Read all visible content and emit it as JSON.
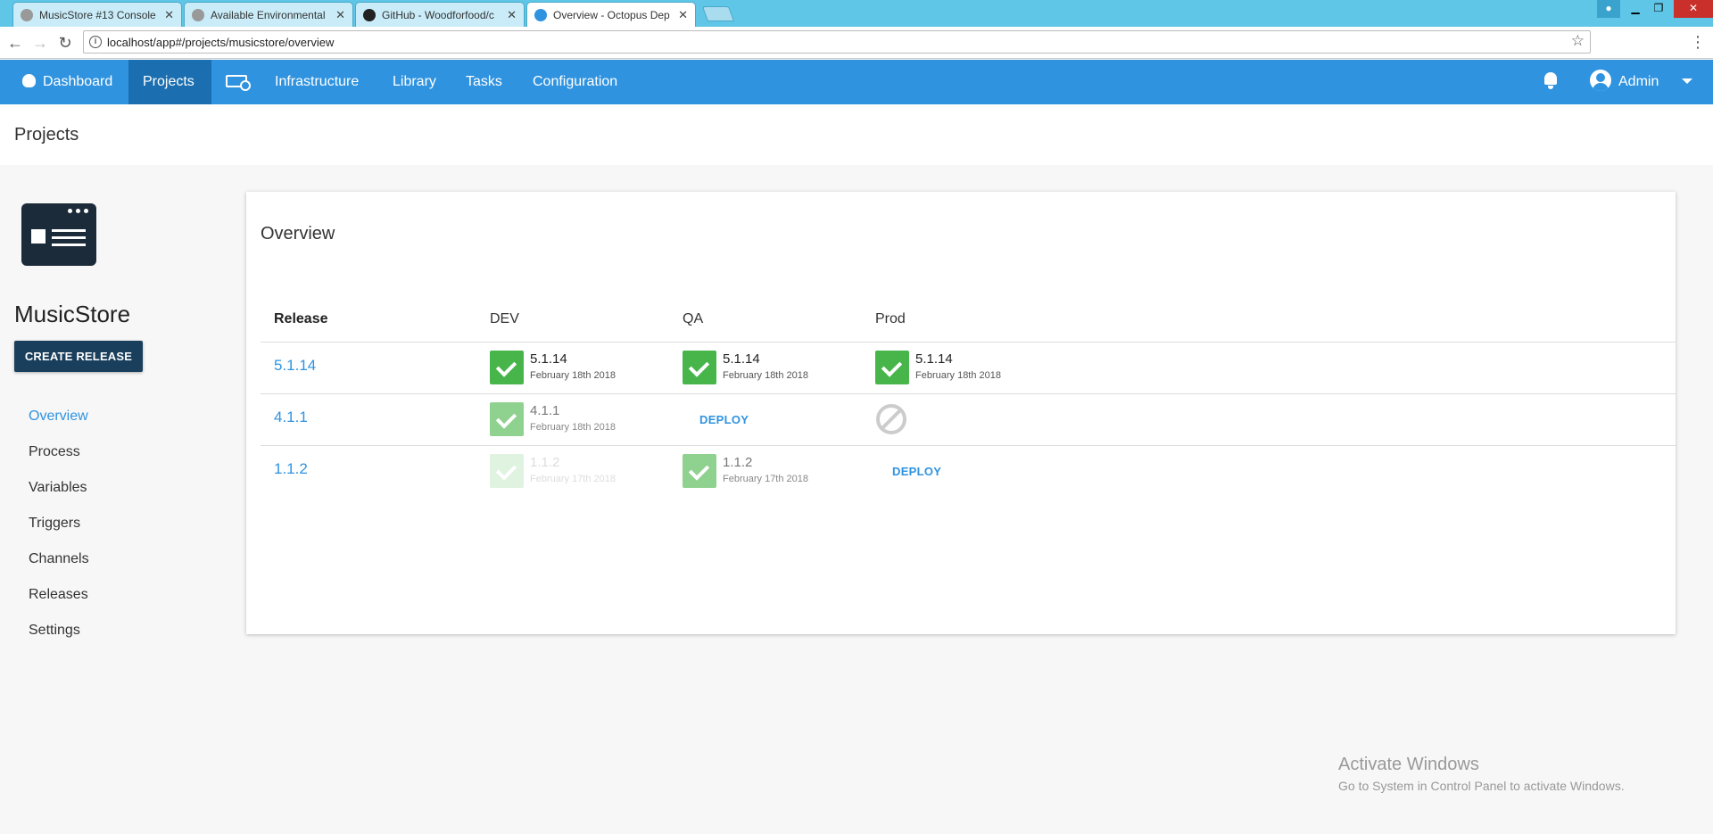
{
  "browser": {
    "tabs": [
      {
        "title": "MusicStore #13 Console"
      },
      {
        "title": "Available Environmental"
      },
      {
        "title": "GitHub - Woodforfood/c"
      },
      {
        "title": "Overview - Octopus Dep"
      }
    ],
    "url": "localhost/app#/projects/musicstore/overview"
  },
  "nav": {
    "dashboard": "Dashboard",
    "projects": "Projects",
    "infrastructure": "Infrastructure",
    "library": "Library",
    "tasks": "Tasks",
    "configuration": "Configuration",
    "user": "Admin"
  },
  "page": {
    "title": "Projects"
  },
  "project": {
    "name": "MusicStore",
    "create_release": "CREATE RELEASE",
    "menu": [
      "Overview",
      "Process",
      "Variables",
      "Triggers",
      "Channels",
      "Releases",
      "Settings"
    ]
  },
  "overview": {
    "heading": "Overview",
    "columns": [
      "Release",
      "DEV",
      "QA",
      "Prod"
    ],
    "rows": [
      {
        "release": "5.1.14",
        "dev": {
          "version": "5.1.14",
          "date": "February 18th 2018",
          "state": "success"
        },
        "qa": {
          "version": "5.1.14",
          "date": "February 18th 2018",
          "state": "success"
        },
        "prod": {
          "version": "5.1.14",
          "date": "February 18th 2018",
          "state": "success"
        }
      },
      {
        "release": "4.1.1",
        "dev": {
          "version": "4.1.1",
          "date": "February 18th 2018",
          "state": "success-previous"
        },
        "qa": {
          "action": "DEPLOY"
        },
        "prod": {
          "state": "blocked"
        }
      },
      {
        "release": "1.1.2",
        "dev": {
          "version": "1.1.2",
          "date": "February 17th 2018",
          "state": "success-old"
        },
        "qa": {
          "version": "1.1.2",
          "date": "February 17th 2018",
          "state": "success-previous"
        },
        "prod": {
          "action": "DEPLOY"
        }
      }
    ]
  },
  "watermark": {
    "line1": "Activate Windows",
    "line2": "Go to System in Control Panel to activate Windows."
  },
  "colors": {
    "accent": "#2f93e0",
    "nav_active": "#1b6fb0",
    "success": "#48b54b",
    "button": "#1a3f5c"
  }
}
